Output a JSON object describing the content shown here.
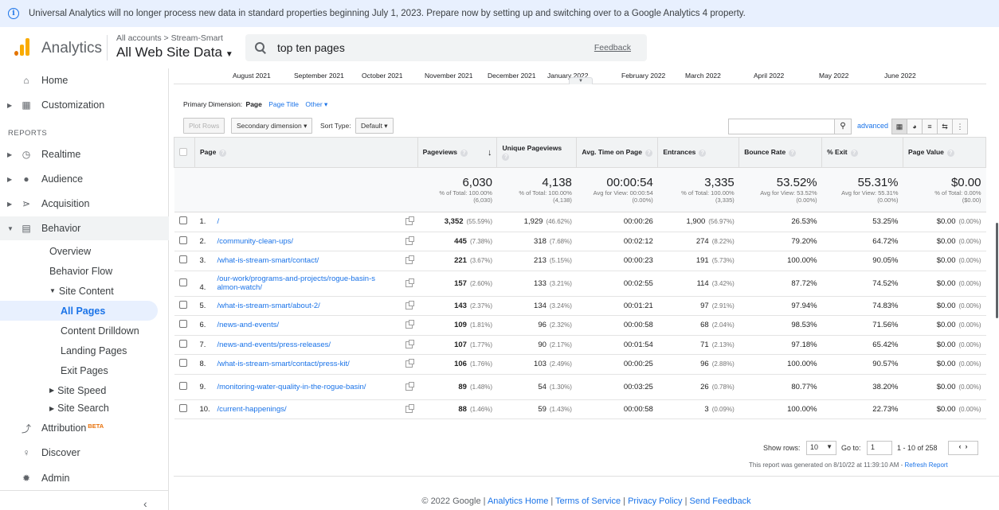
{
  "banner": {
    "text": "Universal Analytics will no longer process new data in standard properties beginning July 1, 2023. Prepare now by setting up and switching over to a Google Analytics 4 property."
  },
  "header": {
    "app_name": "Analytics",
    "breadcrumb": "All accounts > Stream-Smart",
    "view_name": "All Web Site Data",
    "search_query": "top ten pages",
    "feedback": "Feedback"
  },
  "sidebar": {
    "home": "Home",
    "customization": "Customization",
    "reports_label": "REPORTS",
    "realtime": "Realtime",
    "audience": "Audience",
    "acquisition": "Acquisition",
    "behavior": "Behavior",
    "overview": "Overview",
    "behavior_flow": "Behavior Flow",
    "site_content": "Site Content",
    "all_pages": "All Pages",
    "content_drilldown": "Content Drilldown",
    "landing_pages": "Landing Pages",
    "exit_pages": "Exit Pages",
    "site_speed": "Site Speed",
    "site_search": "Site Search",
    "attribution": "Attribution",
    "beta": "BETA",
    "discover": "Discover",
    "admin": "Admin"
  },
  "timeline": [
    "August 2021",
    "September 2021",
    "October 2021",
    "November 2021",
    "December 2021",
    "January 2022",
    "February 2022",
    "March 2022",
    "April 2022",
    "May 2022",
    "June 2022"
  ],
  "dimensions": {
    "label": "Primary Dimension:",
    "primary": "Page",
    "alt": "Page Title",
    "other": "Other"
  },
  "toolbar": {
    "plot_rows": "Plot Rows",
    "secondary": "Secondary dimension",
    "sort_label": "Sort Type:",
    "sort_value": "Default",
    "advanced": "advanced"
  },
  "table": {
    "headers": {
      "page": "Page",
      "pageviews": "Pageviews",
      "unique": "Unique Pageviews",
      "avg_time": "Avg. Time on Page",
      "entrances": "Entrances",
      "bounce": "Bounce Rate",
      "exit": "% Exit",
      "value": "Page Value"
    },
    "totals": {
      "pageviews": "6,030",
      "pageviews_sub1": "% of Total: 100.00%",
      "pageviews_sub2": "(6,030)",
      "unique": "4,138",
      "unique_sub1": "% of Total: 100.00%",
      "unique_sub2": "(4,138)",
      "avg_time": "00:00:54",
      "avg_time_sub1": "Avg for View: 00:00:54",
      "avg_time_sub2": "(0.00%)",
      "entrances": "3,335",
      "entrances_sub1": "% of Total: 100.00%",
      "entrances_sub2": "(3,335)",
      "bounce": "53.52%",
      "bounce_sub1": "Avg for View: 53.52%",
      "bounce_sub2": "(0.00%)",
      "exit": "55.31%",
      "exit_sub1": "Avg for View: 55.31%",
      "exit_sub2": "(0.00%)",
      "value": "$0.00",
      "value_sub1": "% of Total: 0.00%",
      "value_sub2": "($0.00)"
    },
    "rows": [
      {
        "n": "1.",
        "page": "/",
        "pv": "3,352",
        "pv_pct": "(55.59%)",
        "upv": "1,929",
        "upv_pct": "(46.62%)",
        "time": "00:00:26",
        "ent": "1,900",
        "ent_pct": "(56.97%)",
        "bounce": "26.53%",
        "exit": "53.25%",
        "val": "$0.00",
        "val_pct": "(0.00%)"
      },
      {
        "n": "2.",
        "page": "/community-clean-ups/",
        "pv": "445",
        "pv_pct": "(7.38%)",
        "upv": "318",
        "upv_pct": "(7.68%)",
        "time": "00:02:12",
        "ent": "274",
        "ent_pct": "(8.22%)",
        "bounce": "79.20%",
        "exit": "64.72%",
        "val": "$0.00",
        "val_pct": "(0.00%)"
      },
      {
        "n": "3.",
        "page": "/what-is-stream-smart/contact/",
        "pv": "221",
        "pv_pct": "(3.67%)",
        "upv": "213",
        "upv_pct": "(5.15%)",
        "time": "00:00:23",
        "ent": "191",
        "ent_pct": "(5.73%)",
        "bounce": "100.00%",
        "exit": "90.05%",
        "val": "$0.00",
        "val_pct": "(0.00%)"
      },
      {
        "n": "4.",
        "page": "/our-work/programs-and-projects/rogue-basin-salmon-watch/",
        "pv": "157",
        "pv_pct": "(2.60%)",
        "upv": "133",
        "upv_pct": "(3.21%)",
        "time": "00:02:55",
        "ent": "114",
        "ent_pct": "(3.42%)",
        "bounce": "87.72%",
        "exit": "74.52%",
        "val": "$0.00",
        "val_pct": "(0.00%)"
      },
      {
        "n": "5.",
        "page": "/what-is-stream-smart/about-2/",
        "pv": "143",
        "pv_pct": "(2.37%)",
        "upv": "134",
        "upv_pct": "(3.24%)",
        "time": "00:01:21",
        "ent": "97",
        "ent_pct": "(2.91%)",
        "bounce": "97.94%",
        "exit": "74.83%",
        "val": "$0.00",
        "val_pct": "(0.00%)"
      },
      {
        "n": "6.",
        "page": "/news-and-events/",
        "pv": "109",
        "pv_pct": "(1.81%)",
        "upv": "96",
        "upv_pct": "(2.32%)",
        "time": "00:00:58",
        "ent": "68",
        "ent_pct": "(2.04%)",
        "bounce": "98.53%",
        "exit": "71.56%",
        "val": "$0.00",
        "val_pct": "(0.00%)"
      },
      {
        "n": "7.",
        "page": "/news-and-events/press-releases/",
        "pv": "107",
        "pv_pct": "(1.77%)",
        "upv": "90",
        "upv_pct": "(2.17%)",
        "time": "00:01:54",
        "ent": "71",
        "ent_pct": "(2.13%)",
        "bounce": "97.18%",
        "exit": "65.42%",
        "val": "$0.00",
        "val_pct": "(0.00%)"
      },
      {
        "n": "8.",
        "page": "/what-is-stream-smart/contact/press-kit/",
        "pv": "106",
        "pv_pct": "(1.76%)",
        "upv": "103",
        "upv_pct": "(2.49%)",
        "time": "00:00:25",
        "ent": "96",
        "ent_pct": "(2.88%)",
        "bounce": "100.00%",
        "exit": "90.57%",
        "val": "$0.00",
        "val_pct": "(0.00%)"
      },
      {
        "n": "9.",
        "page": "/monitoring-water-quality-in-the-rogue-basin/",
        "pv": "89",
        "pv_pct": "(1.48%)",
        "upv": "54",
        "upv_pct": "(1.30%)",
        "time": "00:03:25",
        "ent": "26",
        "ent_pct": "(0.78%)",
        "bounce": "80.77%",
        "exit": "38.20%",
        "val": "$0.00",
        "val_pct": "(0.00%)"
      },
      {
        "n": "10.",
        "page": "/current-happenings/",
        "pv": "88",
        "pv_pct": "(1.46%)",
        "upv": "59",
        "upv_pct": "(1.43%)",
        "time": "00:00:58",
        "ent": "3",
        "ent_pct": "(0.09%)",
        "bounce": "100.00%",
        "exit": "22.73%",
        "val": "$0.00",
        "val_pct": "(0.00%)"
      }
    ]
  },
  "pagination": {
    "show_rows": "Show rows:",
    "rows_value": "10",
    "goto": "Go to:",
    "goto_value": "1",
    "range": "1 - 10 of 258"
  },
  "report_note": {
    "text": "This report was generated on 8/10/22 at 11:39:10 AM - ",
    "refresh": "Refresh Report"
  },
  "footer": {
    "copyright": "© 2022 Google",
    "home": "Analytics Home",
    "terms": "Terms of Service",
    "privacy": "Privacy Policy",
    "feedback": "Send Feedback"
  }
}
